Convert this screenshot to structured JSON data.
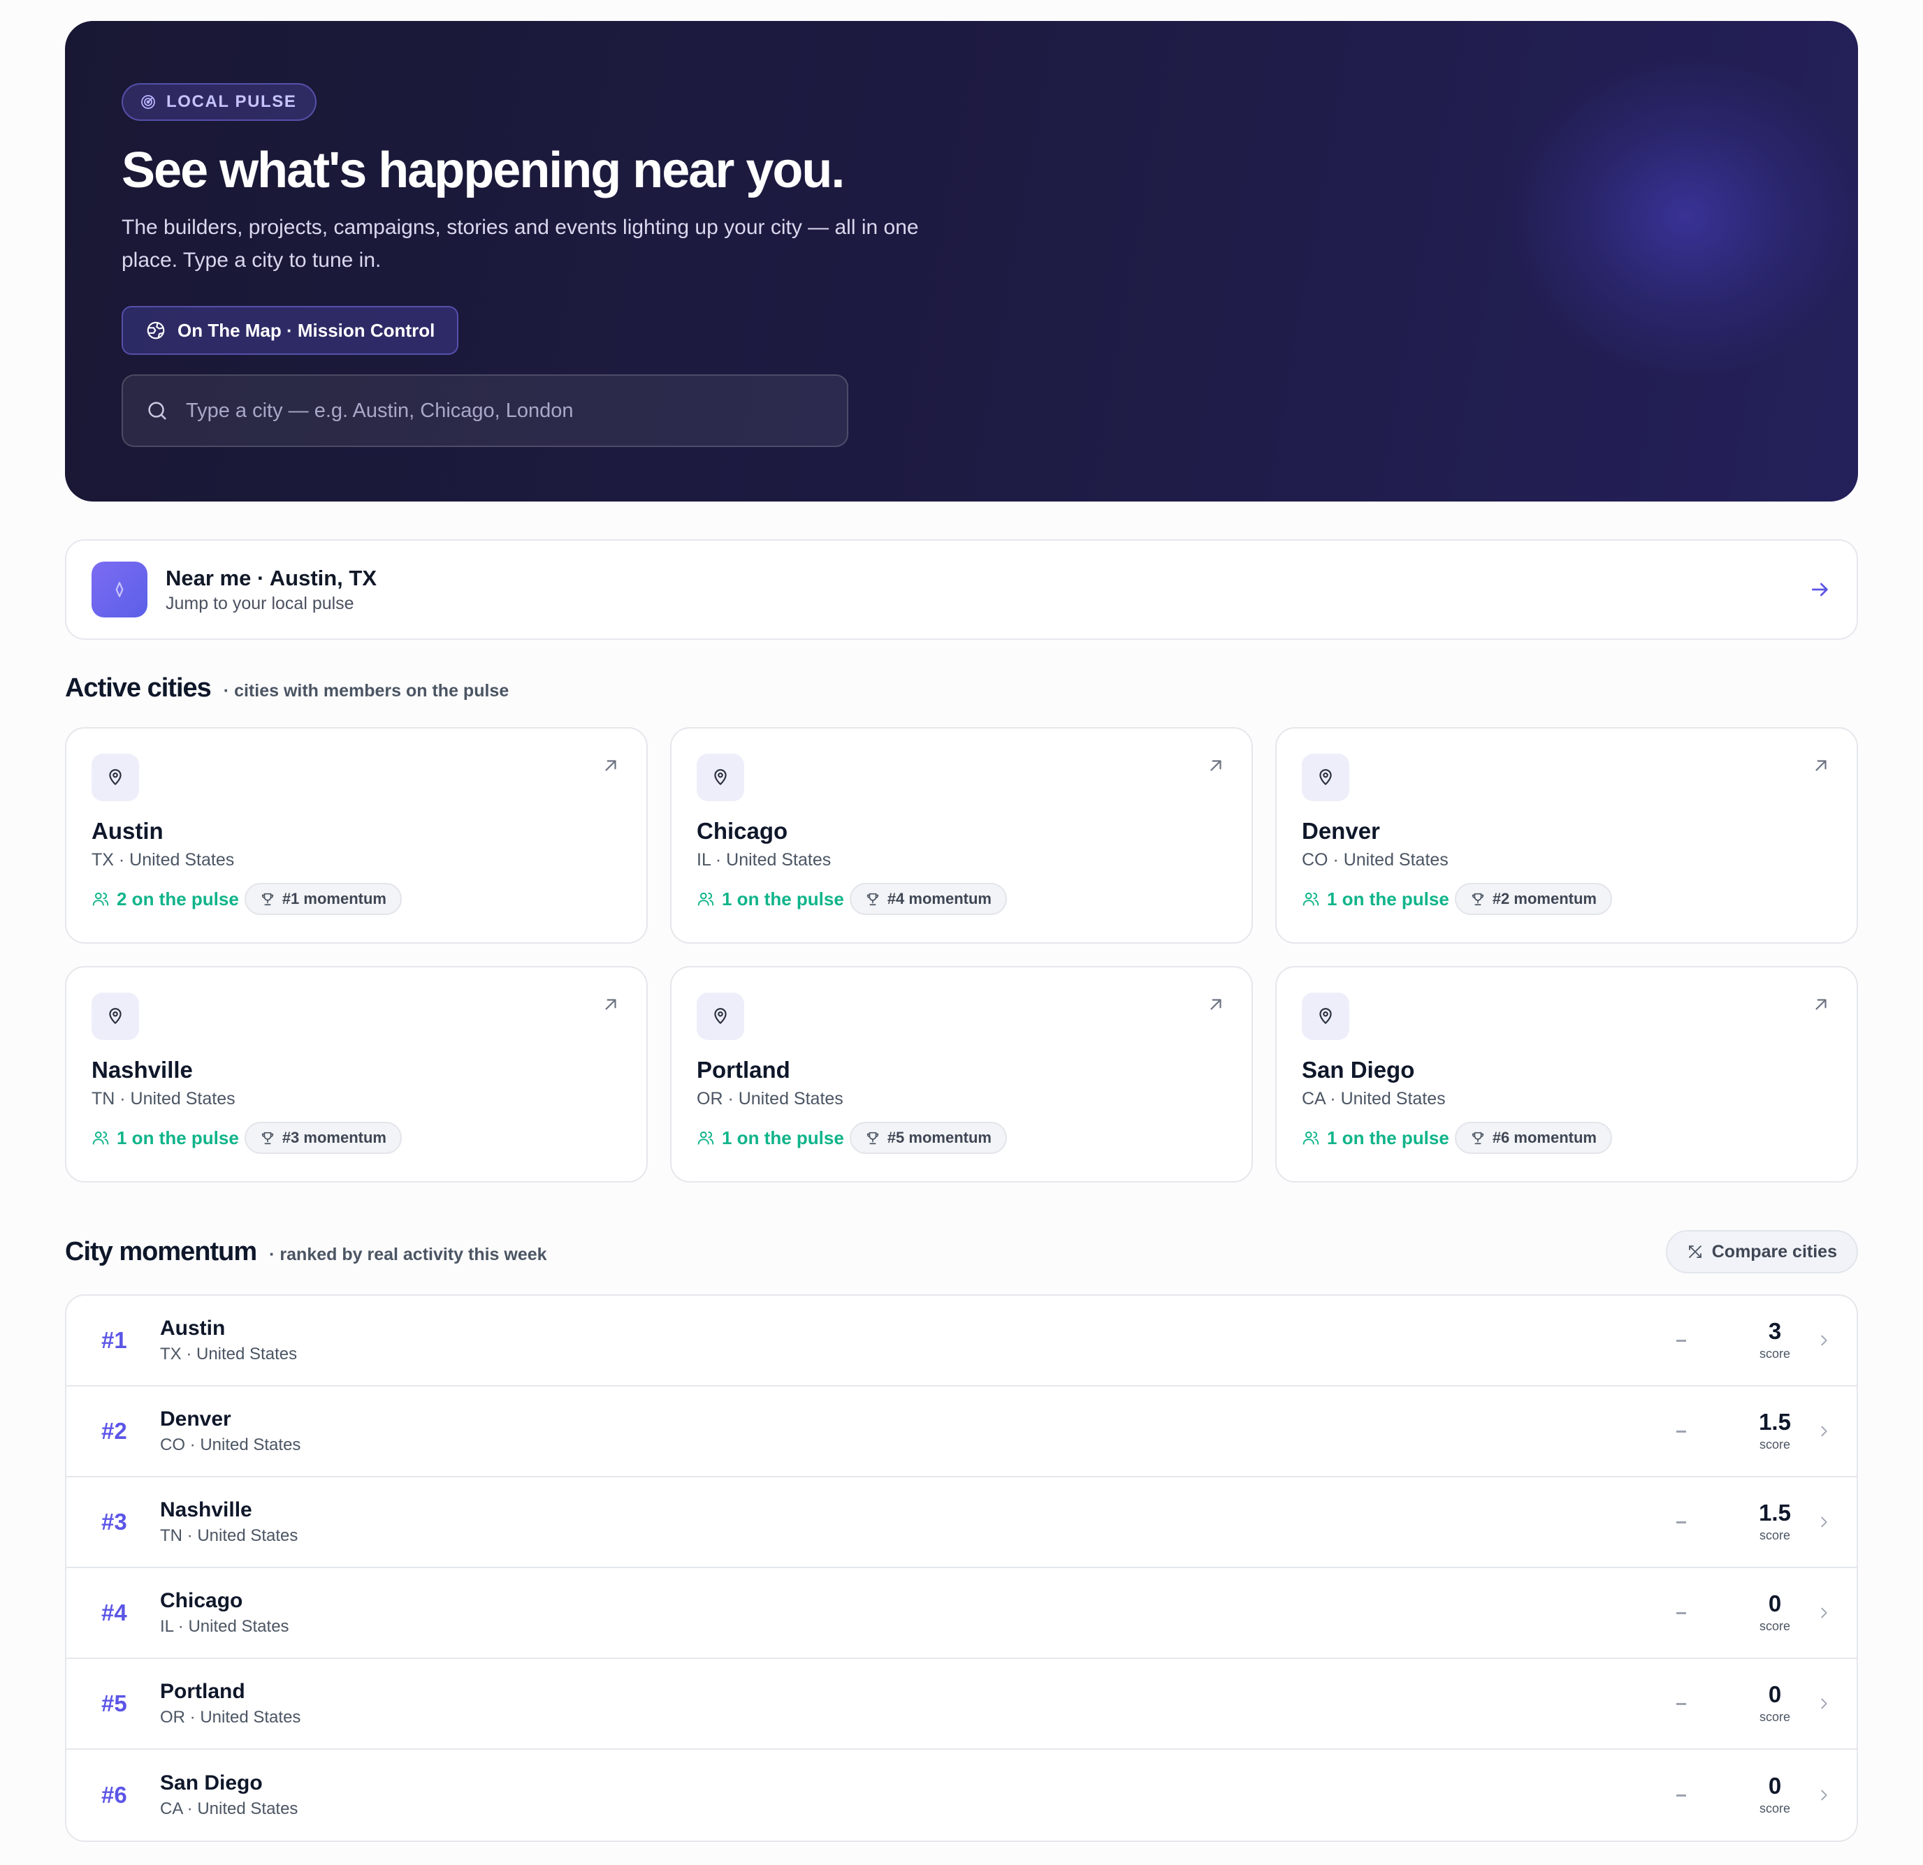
{
  "hero": {
    "badge": "LOCAL PULSE",
    "title": "See what's happening near you.",
    "subtitle": "The builders, projects, campaigns, stories and events lighting up your city — all in one place. Type a city to tune in.",
    "map_button": "On The Map · Mission Control",
    "search_placeholder": "Type a city — e.g. Austin, Chicago, London"
  },
  "near_me": {
    "title": "Near me · Austin, TX",
    "subtitle": "Jump to your local pulse"
  },
  "active_cities": {
    "title": "Active cities",
    "subtitle": "· cities with members on the pulse",
    "cards": [
      {
        "name": "Austin",
        "location": "TX · United States",
        "pulse": "2 on the pulse",
        "momentum": "#1 momentum"
      },
      {
        "name": "Chicago",
        "location": "IL · United States",
        "pulse": "1 on the pulse",
        "momentum": "#4 momentum"
      },
      {
        "name": "Denver",
        "location": "CO · United States",
        "pulse": "1 on the pulse",
        "momentum": "#2 momentum"
      },
      {
        "name": "Nashville",
        "location": "TN · United States",
        "pulse": "1 on the pulse",
        "momentum": "#3 momentum"
      },
      {
        "name": "Portland",
        "location": "OR · United States",
        "pulse": "1 on the pulse",
        "momentum": "#5 momentum"
      },
      {
        "name": "San Diego",
        "location": "CA · United States",
        "pulse": "1 on the pulse",
        "momentum": "#6 momentum"
      }
    ]
  },
  "city_momentum": {
    "title": "City momentum",
    "subtitle": "· ranked by real activity this week",
    "compare_button": "Compare cities",
    "rows": [
      {
        "rank": "#1",
        "name": "Austin",
        "location": "TX · United States",
        "score": "3",
        "score_label": "score"
      },
      {
        "rank": "#2",
        "name": "Denver",
        "location": "CO · United States",
        "score": "1.5",
        "score_label": "score"
      },
      {
        "rank": "#3",
        "name": "Nashville",
        "location": "TN · United States",
        "score": "1.5",
        "score_label": "score"
      },
      {
        "rank": "#4",
        "name": "Chicago",
        "location": "IL · United States",
        "score": "0",
        "score_label": "score"
      },
      {
        "rank": "#5",
        "name": "Portland",
        "location": "OR · United States",
        "score": "0",
        "score_label": "score"
      },
      {
        "rank": "#6",
        "name": "San Diego",
        "location": "CA · United States",
        "score": "0",
        "score_label": "score"
      }
    ]
  },
  "colors": {
    "accent": "#5b55e6",
    "pulse_green": "#10b48a",
    "hero_bg": "#1c1a3e"
  },
  "icons": {
    "badge": "radar-icon",
    "map_button": "globe-icon",
    "search": "search-icon",
    "near_me": "compass-icon",
    "near_me_arrow": "arrow-right-icon",
    "card_pin": "map-pin-icon",
    "card_arrow": "arrow-up-right-icon",
    "pulse": "users-icon",
    "momentum": "trophy-icon",
    "compare": "swap-icon",
    "row_chevron": "chevron-right-icon"
  }
}
